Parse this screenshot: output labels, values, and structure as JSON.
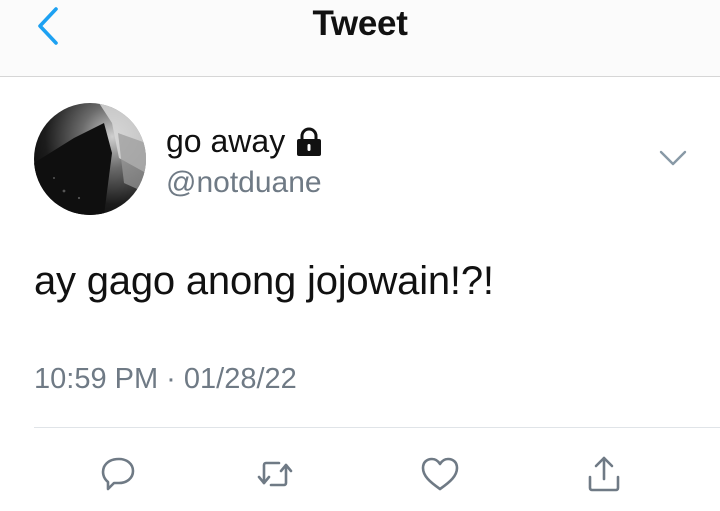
{
  "header": {
    "title": "Tweet",
    "back_icon": "chevron-left-icon"
  },
  "tweet": {
    "author": {
      "display_name": "go away",
      "handle": "@notduane",
      "protected_icon": "lock-icon",
      "avatar": "avatar-photo"
    },
    "text": "ay gago anong jojowain!?!",
    "timestamp": "10:59 PM · 01/28/22",
    "more_icon": "chevron-down-icon"
  },
  "actions": [
    {
      "name": "reply",
      "icon": "reply-icon"
    },
    {
      "name": "retweet",
      "icon": "retweet-icon"
    },
    {
      "name": "like",
      "icon": "heart-icon"
    },
    {
      "name": "share",
      "icon": "share-icon"
    }
  ],
  "colors": {
    "accent": "#1da1f2",
    "icon_gray": "#6f7a85",
    "text": "#14171a"
  }
}
